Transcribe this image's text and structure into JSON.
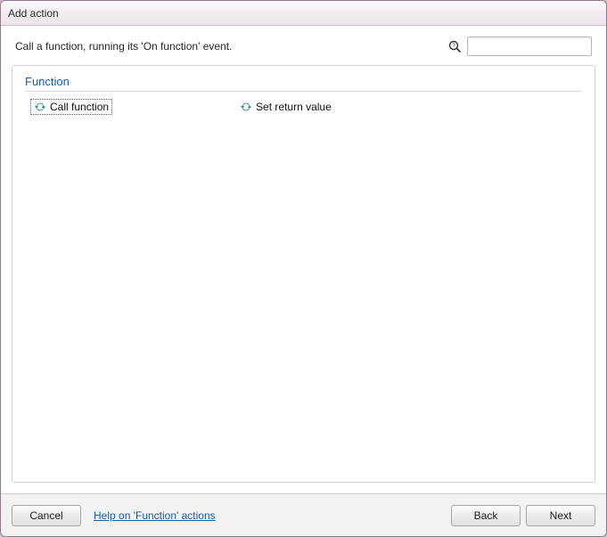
{
  "window": {
    "title": "Add action"
  },
  "description": "Call a function, running its 'On function' event.",
  "search": {
    "value": "",
    "placeholder": ""
  },
  "group": {
    "header": "Function",
    "items": [
      {
        "label": "Call function",
        "selected": true
      },
      {
        "label": "Set return value",
        "selected": false
      }
    ]
  },
  "footer": {
    "cancel": "Cancel",
    "help": "Help on 'Function' actions",
    "back": "Back",
    "next": "Next"
  }
}
